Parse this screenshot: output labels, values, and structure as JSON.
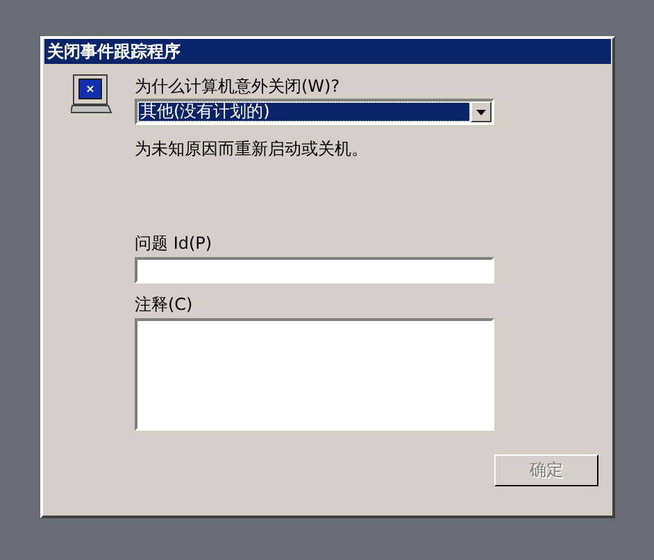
{
  "window": {
    "title": "关闭事件跟踪程序"
  },
  "reason": {
    "label": "为什么计算机意外关闭(W)?",
    "value": "其他(没有计划的)",
    "focused": true
  },
  "description": "为未知原因而重新启动或关机。",
  "problem_id": {
    "label": "问题 Id(P)"
  },
  "comment": {
    "label": "注释(C)"
  },
  "ok_button": {
    "label": "确定",
    "disabled": true
  }
}
